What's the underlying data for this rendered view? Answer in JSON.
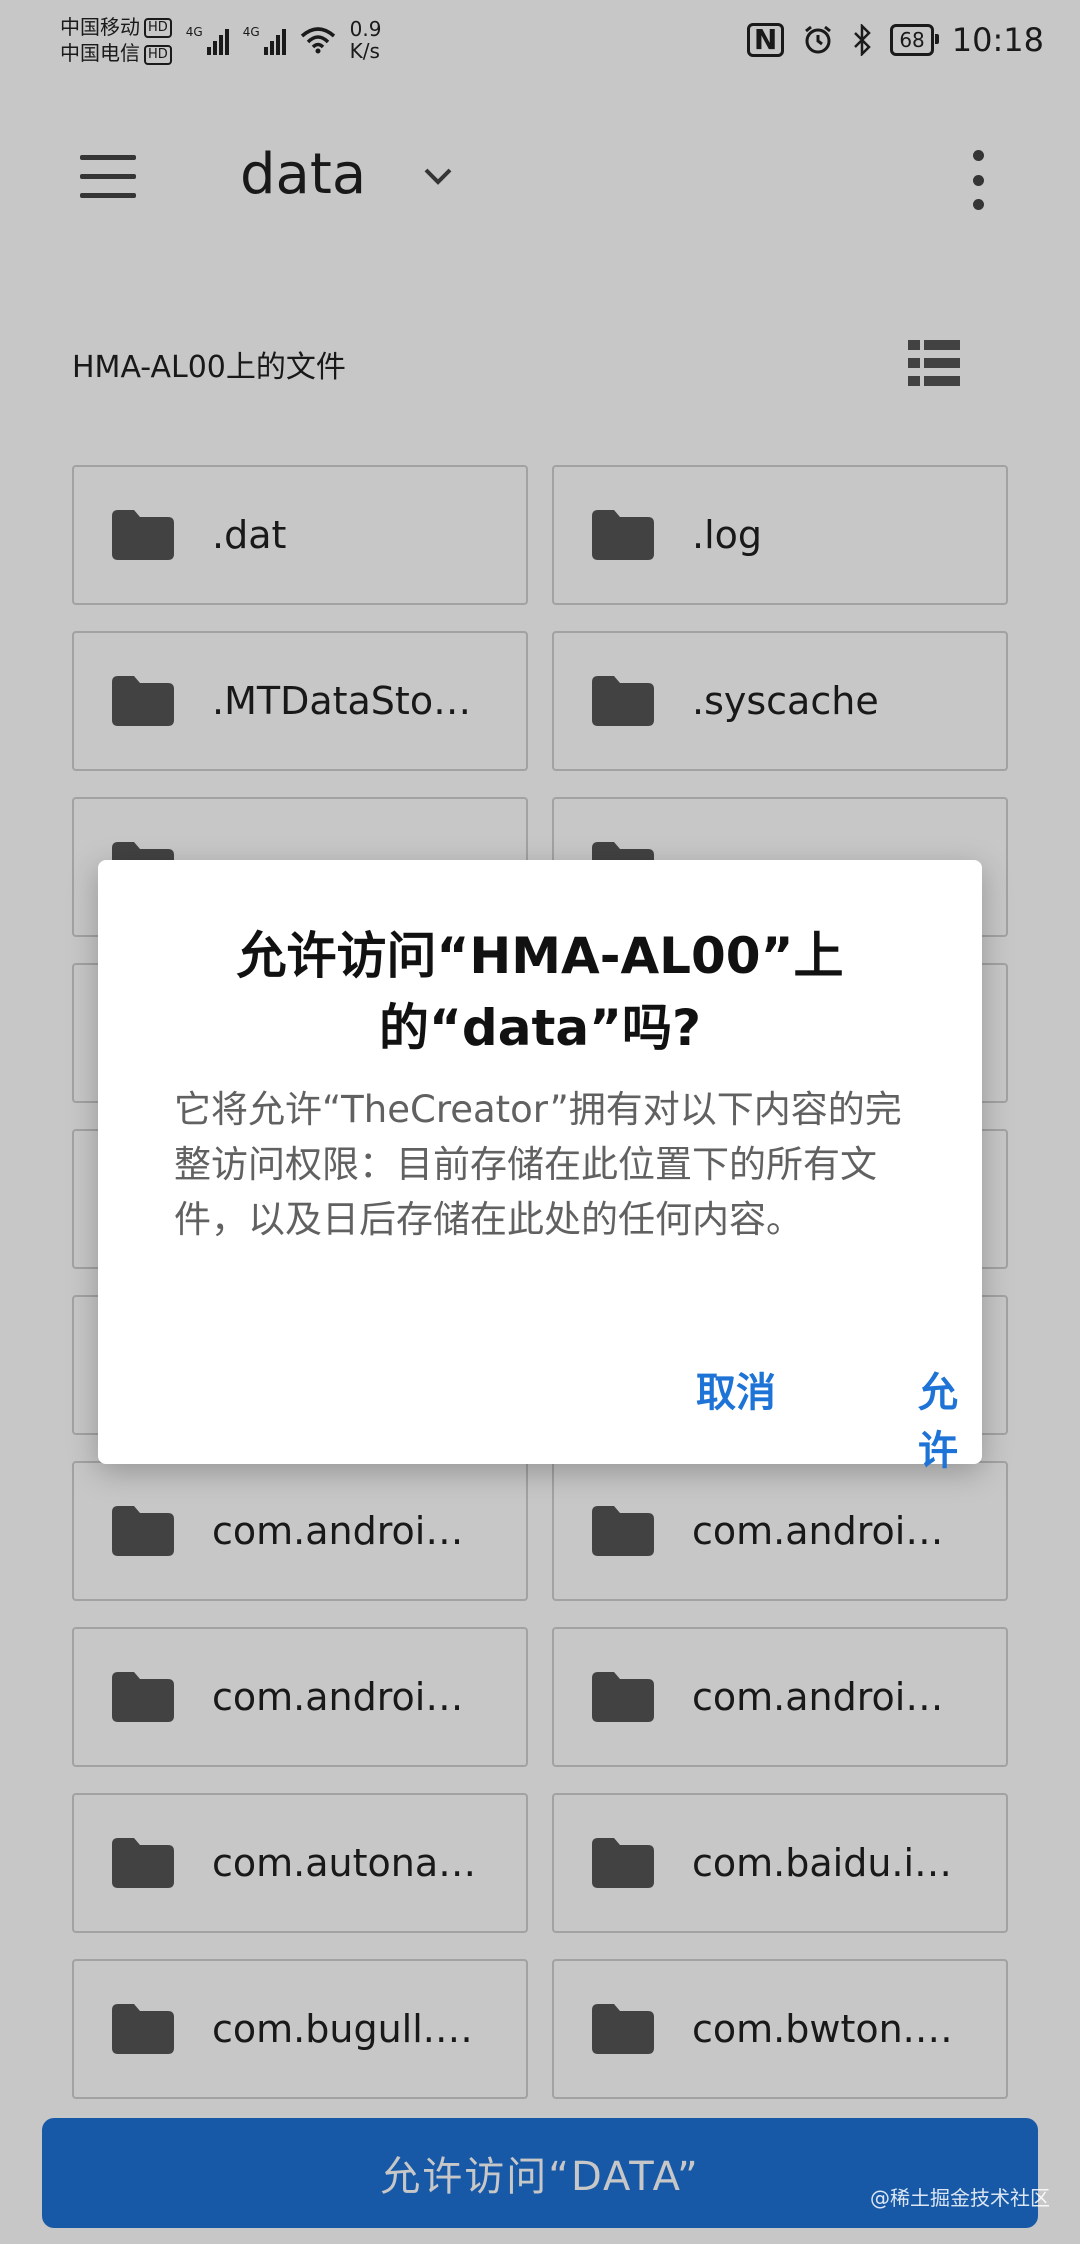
{
  "status_bar": {
    "carrier1": "中国移动",
    "carrier2": "中国电信",
    "hd_badge": "HD",
    "net1": "4G",
    "net2": "4G",
    "speed_value": "0.9",
    "speed_unit": "K/s",
    "nfc_glyph": "N",
    "battery": "68",
    "time": "10:18"
  },
  "app_bar": {
    "title": "data"
  },
  "subheader": "HMA-AL00上的文件",
  "folders": [
    ".dat",
    ".log",
    ".MTDataSto…",
    ".syscache",
    "",
    "",
    "",
    "",
    "",
    "",
    "",
    "",
    "com.androi…",
    "com.androi…",
    "com.androi…",
    "com.androi…",
    "com.autona…",
    "com.baidu.i…",
    "com.bugull.…",
    "com.bwton.…"
  ],
  "bottom_button": "允许访问“DATA”",
  "dialog": {
    "title": "允许访问“HMA-AL00”上的“data”吗?",
    "body": "它将允许“TheCreator”拥有对以下内容的完整访问权限：目前存储在此位置下的所有文件，以及日后存储在此处的任何内容。",
    "cancel": "取消",
    "allow": "允许"
  },
  "watermark": "@稀土掘金技术社区",
  "colors": {
    "accent": "#1e73d6",
    "icon": "#555555"
  }
}
